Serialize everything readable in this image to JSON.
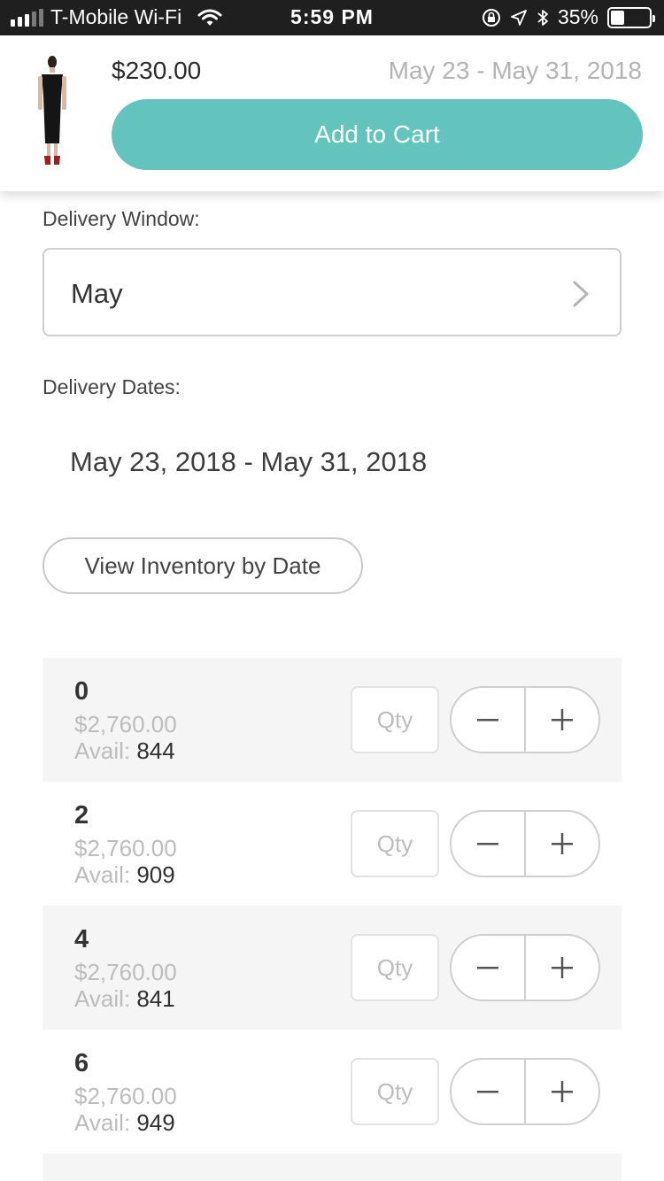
{
  "status_bar": {
    "carrier": "T-Mobile Wi-Fi",
    "time": "5:59 PM",
    "battery": "35%",
    "battery_level": 0.35
  },
  "header": {
    "price": "$230.00",
    "date_range": "May 23 - May 31, 2018",
    "add_to_cart_label": "Add to Cart",
    "accent_color": "#62c4bd"
  },
  "delivery_window": {
    "label": "Delivery Window:",
    "value": "May"
  },
  "delivery_dates": {
    "label": "Delivery Dates:",
    "value": "May 23, 2018 - May 31, 2018"
  },
  "inventory_button_label": "View Inventory by Date",
  "variants": [
    {
      "size": "0",
      "price": "$2,760.00",
      "avail_label": "Avail:",
      "avail": "844",
      "qty_placeholder": "Qty"
    },
    {
      "size": "2",
      "price": "$2,760.00",
      "avail_label": "Avail:",
      "avail": "909",
      "qty_placeholder": "Qty"
    },
    {
      "size": "4",
      "price": "$2,760.00",
      "avail_label": "Avail:",
      "avail": "841",
      "qty_placeholder": "Qty"
    },
    {
      "size": "6",
      "price": "$2,760.00",
      "avail_label": "Avail:",
      "avail": "949",
      "qty_placeholder": "Qty"
    }
  ]
}
